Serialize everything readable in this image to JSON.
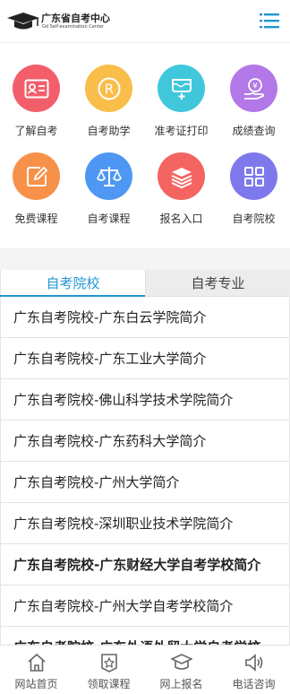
{
  "header": {
    "logo_title": "广东省自考中心",
    "logo_subtitle": "Gd Self-examination Center",
    "menu_icon": "menu-icon"
  },
  "colors": {
    "accent": "#2196d3",
    "red": "#f25f6b",
    "yellow": "#f9bd4a",
    "cyan": "#40c7dc",
    "purple": "#b278e8",
    "orange": "#f7914a",
    "blue": "#4e98f4",
    "coral": "#f46461",
    "indigo": "#7d79ec"
  },
  "grid": {
    "items": [
      {
        "label": "了解自考",
        "icon": "id-card-icon"
      },
      {
        "label": "自考助学",
        "icon": "registered-icon"
      },
      {
        "label": "准考证打印",
        "icon": "print-icon"
      },
      {
        "label": "成绩查询",
        "icon": "yen-hand-icon"
      },
      {
        "label": "免费课程",
        "icon": "edit-icon"
      },
      {
        "label": "自考课程",
        "icon": "scale-icon"
      },
      {
        "label": "报名入口",
        "icon": "layers-icon"
      },
      {
        "label": "自考院校",
        "icon": "grid-icon"
      }
    ]
  },
  "tabs": [
    {
      "label": "自考院校",
      "active": true
    },
    {
      "label": "自考专业",
      "active": false
    }
  ],
  "list": {
    "items": [
      "广东自考院校-广东白云学院简介",
      "广东自考院校-广东工业大学简介",
      "广东自考院校-佛山科学技术学院简介",
      "广东自考院校-广东药科大学简介",
      "广东自考院校-广州大学简介",
      "广东自考院校-深圳职业技术学院简介",
      "广东自考院校-广东财经大学自考学校简介",
      "广东自考院校-广州大学自考学校简介",
      "广东自考院校-广东外语外贸大学自考学校"
    ]
  },
  "bottom_nav": {
    "items": [
      {
        "label": "网站首页",
        "icon": "home-icon"
      },
      {
        "label": "领取课程",
        "icon": "star-badge-icon"
      },
      {
        "label": "网上报名",
        "icon": "graduation-cap-icon"
      },
      {
        "label": "电话咨询",
        "icon": "speaker-icon"
      }
    ]
  }
}
